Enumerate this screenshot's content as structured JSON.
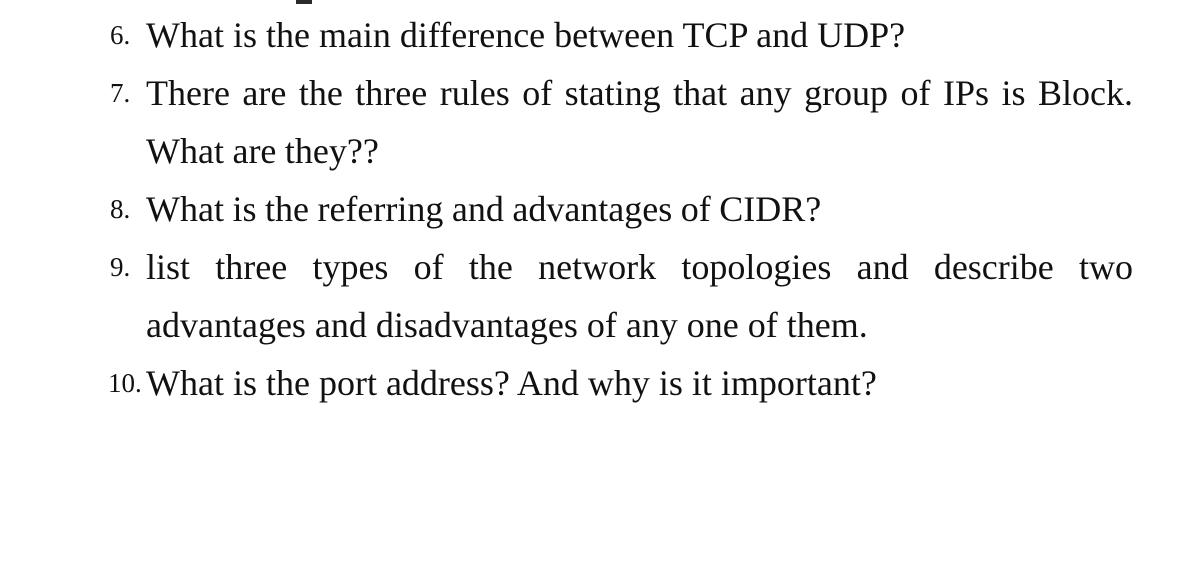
{
  "document": {
    "type": "exam-question-list",
    "background_color": "#ffffff",
    "text_color": "#111111",
    "questions": [
      {
        "number": "6.",
        "text": "What is the main difference between TCP and UDP?"
      },
      {
        "number": "7.",
        "text": "There are the three rules of stating that any group of IPs is Block. What are they??"
      },
      {
        "number": "8.",
        "text": "What is the referring and  advantages of CIDR?"
      },
      {
        "number": "9.",
        "text": "list three types of the network topologies and describe two advantages and disadvantages of any one of them."
      },
      {
        "number": "10.",
        "text": "What is the port address? And why is it important?"
      }
    ]
  }
}
